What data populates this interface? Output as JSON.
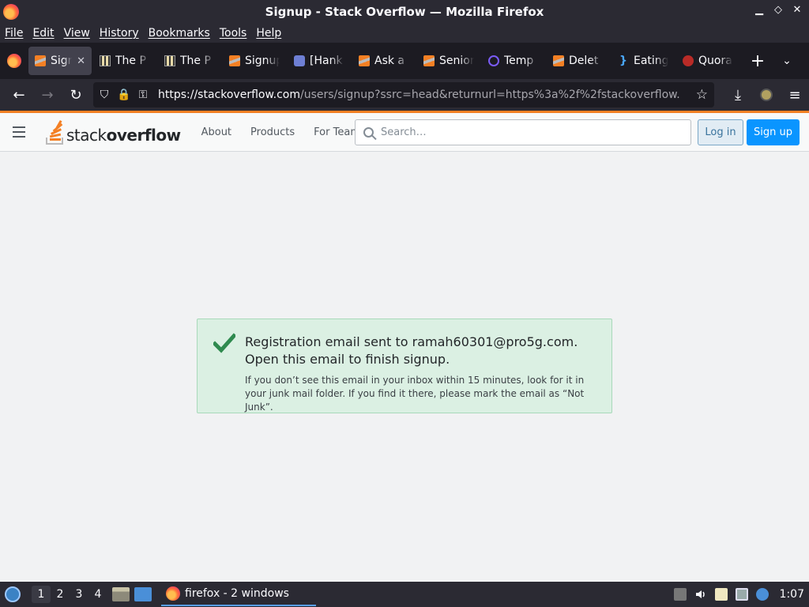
{
  "window": {
    "title": "Signup - Stack Overflow — Mozilla Firefox",
    "controls": [
      "▁",
      "◇",
      "✕"
    ]
  },
  "menubar": [
    "File",
    "Edit",
    "View",
    "History",
    "Bookmarks",
    "Tools",
    "Help"
  ],
  "tabs": [
    {
      "label": "Signup - Stack Overflow",
      "icon": "stackoverflow-icon",
      "active": true,
      "close": "✕"
    },
    {
      "label": "The P",
      "icon": "film-icon"
    },
    {
      "label": "The P",
      "icon": "film-icon"
    },
    {
      "label": "Signup",
      "icon": "stackoverflow-icon"
    },
    {
      "label": "[Hank",
      "icon": "quote-icon"
    },
    {
      "label": "Ask a",
      "icon": "stackoverflow-icon"
    },
    {
      "label": "Senior",
      "icon": "stackoverflow-icon"
    },
    {
      "label": "Temp",
      "icon": "at-icon"
    },
    {
      "label": "Delet",
      "icon": "stackoverflow-icon"
    },
    {
      "label": "Eating",
      "icon": "brace-icon"
    },
    {
      "label": "Quora",
      "icon": "quora-icon"
    }
  ],
  "tabstrip": {
    "new_tab": "+",
    "list_tabs": "⌄"
  },
  "navbar": {
    "back": "←",
    "forward": "→",
    "reload": "↻",
    "url_host": "https://stackoverflow.com",
    "url_rest": "/users/signup?ssrc=head&returnurl=https%3a%2f%2fstackoverflow.",
    "shield": "⛉",
    "lock": "🔒",
    "key": "⚿",
    "star": "☆",
    "download": "⤓",
    "menu": "≡"
  },
  "so": {
    "logo_light": "stack",
    "logo_bold": "overflow",
    "nav": [
      "About",
      "Products",
      "For Teams"
    ],
    "search_placeholder": "Search…",
    "login": "Log in",
    "signup": "Sign up"
  },
  "notice": {
    "headline": "Registration email sent to ramah60301@pro5g.com. Open this email to finish signup.",
    "detail": "If you don’t see this email in your inbox within 15 minutes, look for it in your junk mail folder. If you find it there, please mark the email as “Not Junk”."
  },
  "taskbar": {
    "workspaces": [
      "1",
      "2",
      "3",
      "4"
    ],
    "active_workspace": "1",
    "window_label": "firefox - 2 windows",
    "clock": "1:07"
  },
  "colors": {
    "so_orange": "#f48024",
    "so_blue": "#0a95ff",
    "success_bg": "#dbf0e3",
    "success_check": "#2f8a4f"
  }
}
